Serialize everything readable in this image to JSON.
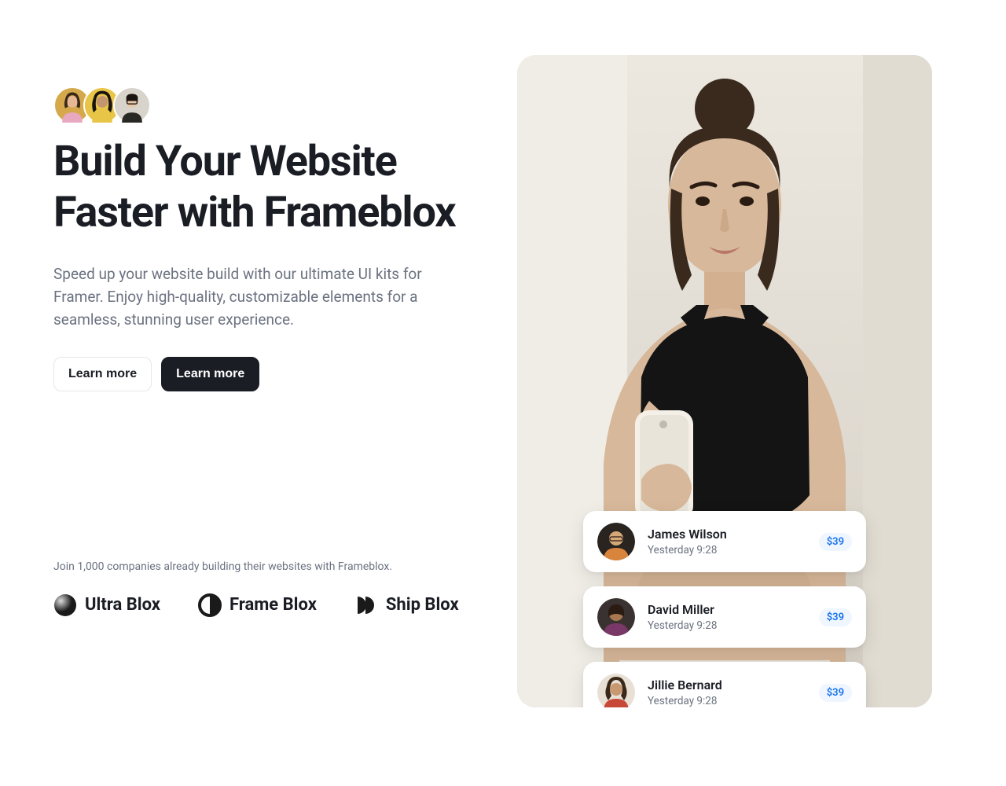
{
  "hero": {
    "heading": "Build Your Website Faster with Frameblox",
    "subtext": "Speed up your website build with our ultimate UI kits for Framer. Enjoy high-quality, customizable elements for a seamless, stunning user experience.",
    "button_light": "Learn more",
    "button_dark": "Learn more"
  },
  "social_proof": "Join 1,000 companies already building their websites with Frameblox.",
  "logos": [
    {
      "name": "Ultra Blox"
    },
    {
      "name": "Frame Blox"
    },
    {
      "name": "Ship Blox"
    }
  ],
  "cards": [
    {
      "name": "James Wilson",
      "time": "Yesterday 9:28",
      "price": "$39"
    },
    {
      "name": "David Miller",
      "time": "Yesterday 9:28",
      "price": "$39"
    },
    {
      "name": "Jillie Bernard",
      "time": "Yesterday 9:28",
      "price": "$39"
    }
  ]
}
